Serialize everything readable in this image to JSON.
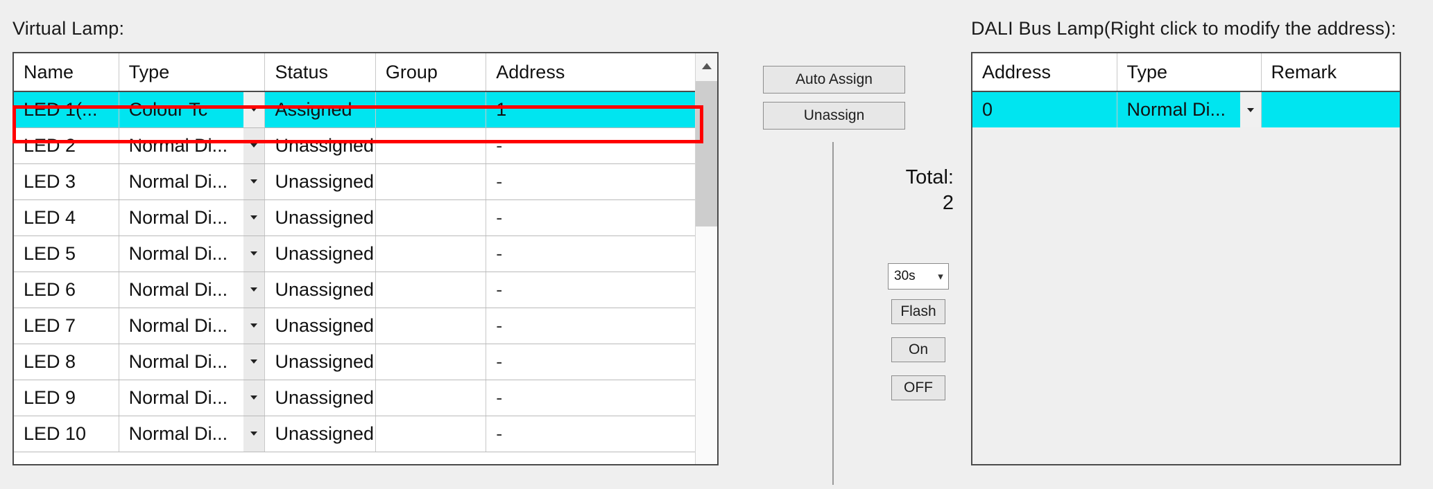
{
  "left_panel": {
    "caption": "Virtual Lamp:",
    "columns": [
      "Name",
      "Type",
      "Status",
      "Group",
      "Address"
    ],
    "rows": [
      {
        "name": "LED 1(...",
        "type": "Colour Tc",
        "status": "Assigned",
        "group": "",
        "address": "1",
        "selected": true
      },
      {
        "name": "LED 2",
        "type": "Normal Di...",
        "status": "Unassigned",
        "group": "",
        "address": "-",
        "selected": false
      },
      {
        "name": "LED 3",
        "type": "Normal Di...",
        "status": "Unassigned",
        "group": "",
        "address": "-",
        "selected": false
      },
      {
        "name": "LED 4",
        "type": "Normal Di...",
        "status": "Unassigned",
        "group": "",
        "address": "-",
        "selected": false
      },
      {
        "name": "LED 5",
        "type": "Normal Di...",
        "status": "Unassigned",
        "group": "",
        "address": "-",
        "selected": false
      },
      {
        "name": "LED 6",
        "type": "Normal Di...",
        "status": "Unassigned",
        "group": "",
        "address": "-",
        "selected": false
      },
      {
        "name": "LED 7",
        "type": "Normal Di...",
        "status": "Unassigned",
        "group": "",
        "address": "-",
        "selected": false
      },
      {
        "name": "LED 8",
        "type": "Normal Di...",
        "status": "Unassigned",
        "group": "",
        "address": "-",
        "selected": false
      },
      {
        "name": "LED 9",
        "type": "Normal Di...",
        "status": "Unassigned",
        "group": "",
        "address": "-",
        "selected": false
      },
      {
        "name": "LED 10",
        "type": "Normal Di...",
        "status": "Unassigned",
        "group": "",
        "address": "-",
        "selected": false
      }
    ],
    "scrollbar": {
      "up_arrow": "chevron-up-icon"
    }
  },
  "center_panel": {
    "auto_assign_label": "Auto Assign",
    "unassign_label": "Unassign",
    "total_label": "Total:",
    "total_value": "2",
    "duration_value": "30s",
    "flash_label": "Flash",
    "on_label": "On",
    "off_label": "OFF"
  },
  "right_panel": {
    "caption": "DALI Bus Lamp(Right click to modify the address):",
    "columns": [
      "Address",
      "Type",
      "Remark"
    ],
    "rows": [
      {
        "address": "0",
        "type": "Normal Di...",
        "remark": "",
        "selected": true
      }
    ]
  },
  "colors": {
    "selection_cyan": "#00e5f0",
    "highlight_red": "#ff0000",
    "window_background": "#efefef",
    "grid_border": "#4a4a4a"
  }
}
